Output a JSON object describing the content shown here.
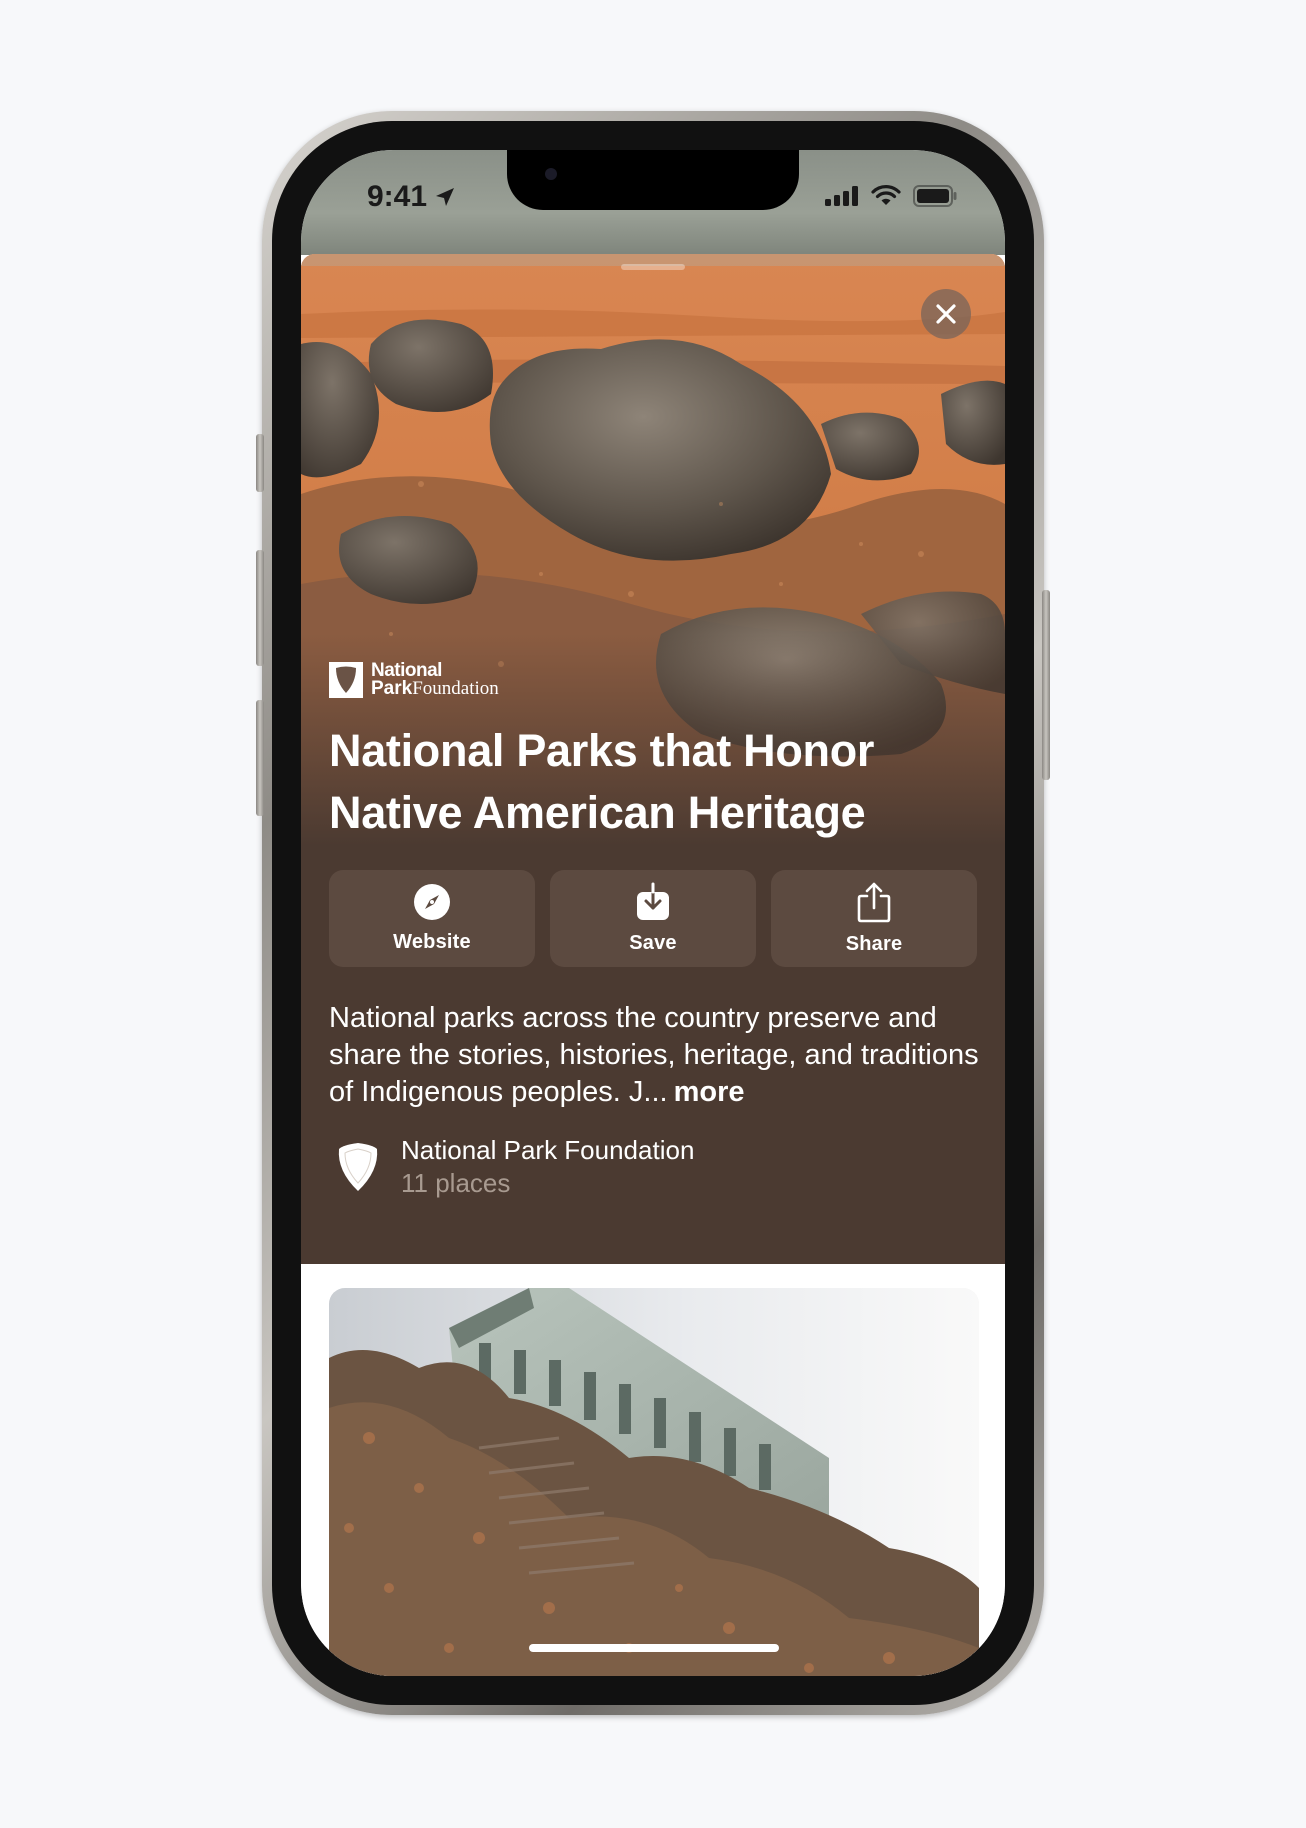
{
  "status_bar": {
    "time": "9:41"
  },
  "hero": {
    "brand_line1": "National",
    "brand_line2_bold": "Park",
    "brand_line2_light": "Foundation",
    "title": "National Parks that Honor Native American Heritage"
  },
  "actions": [
    {
      "label": "Website",
      "icon": "compass-icon"
    },
    {
      "label": "Save",
      "icon": "download-icon"
    },
    {
      "label": "Share",
      "icon": "share-icon"
    }
  ],
  "description": {
    "text": "National parks across the country preserve and share the stories, histories, heritage, and traditions of Indigenous peoples. J...",
    "more_label": "more"
  },
  "publisher": {
    "name": "National Park Foundation",
    "count": "11 places"
  },
  "colors": {
    "panel_brown": "#4b3a31",
    "button_brown": "#5c4a40",
    "background": "#f7f8fa"
  }
}
